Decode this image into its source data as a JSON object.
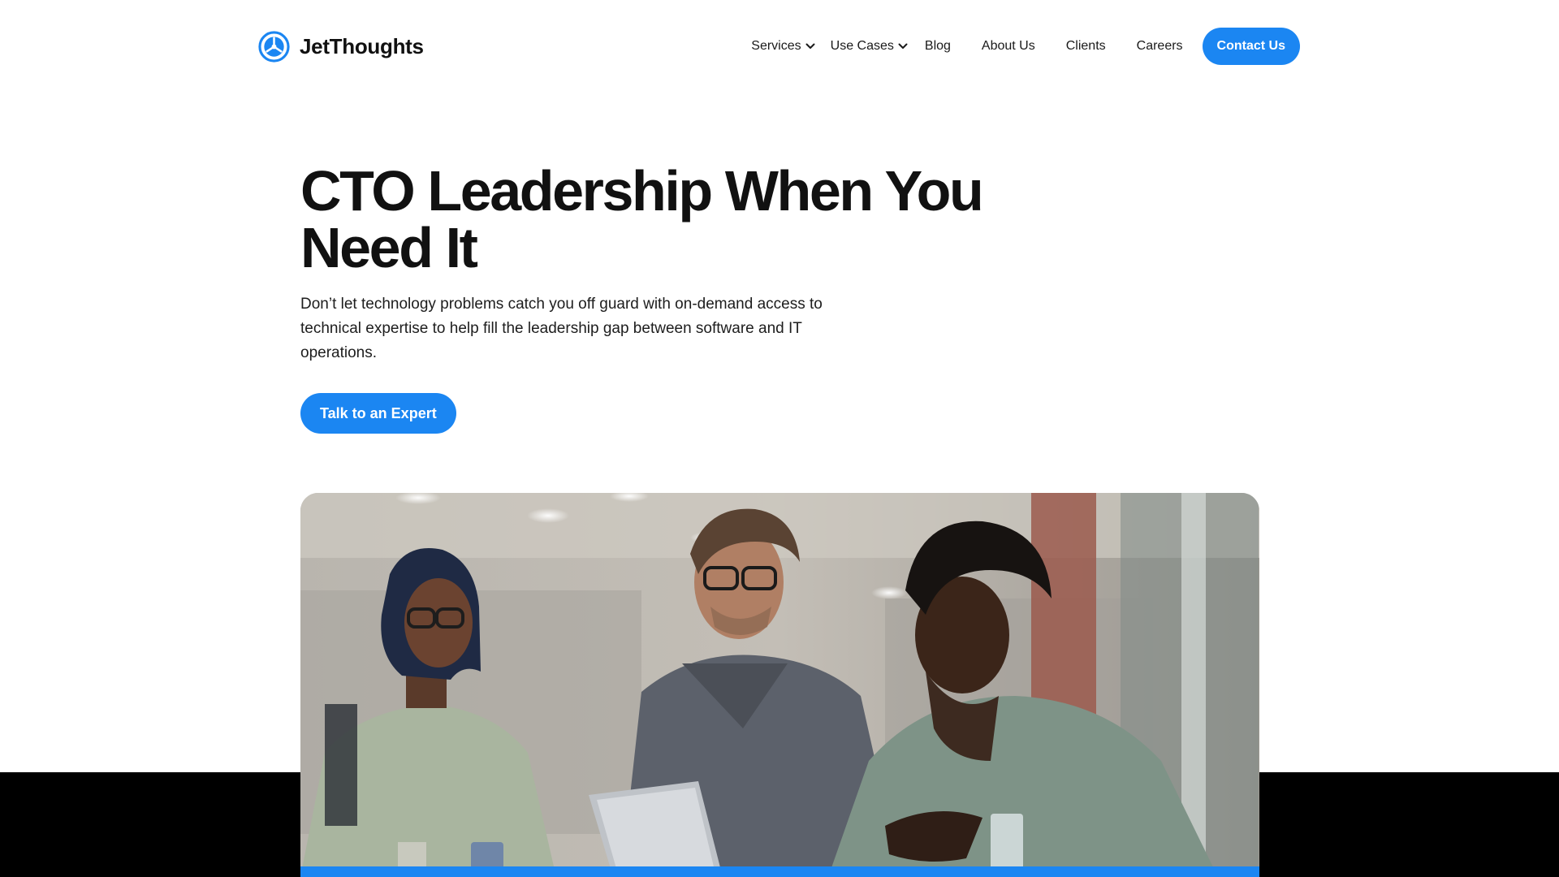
{
  "brand": {
    "name": "JetThoughts",
    "icon": "jetthoughts-logo-icon",
    "accent_color": "#1b86f2"
  },
  "nav": {
    "items": [
      {
        "label": "Services",
        "dropdown": true
      },
      {
        "label": "Use Cases",
        "dropdown": true
      },
      {
        "label": "Blog",
        "dropdown": false
      },
      {
        "label": "About Us",
        "dropdown": false
      },
      {
        "label": "Clients",
        "dropdown": false
      },
      {
        "label": "Careers",
        "dropdown": false
      }
    ],
    "dropdown_icon": "chevron-down-icon",
    "contact_label": "Contact Us"
  },
  "hero": {
    "title": "CTO Leadership When You Need It",
    "subtitle": "Don’t let technology problems catch you off guard with on-demand access to technical expertise to help fill the leadership gap between software and IT operations.",
    "cta_label": "Talk to an Expert"
  },
  "colors": {
    "primary_button": "#1b86f2",
    "text": "#111111",
    "band": "#000000"
  }
}
